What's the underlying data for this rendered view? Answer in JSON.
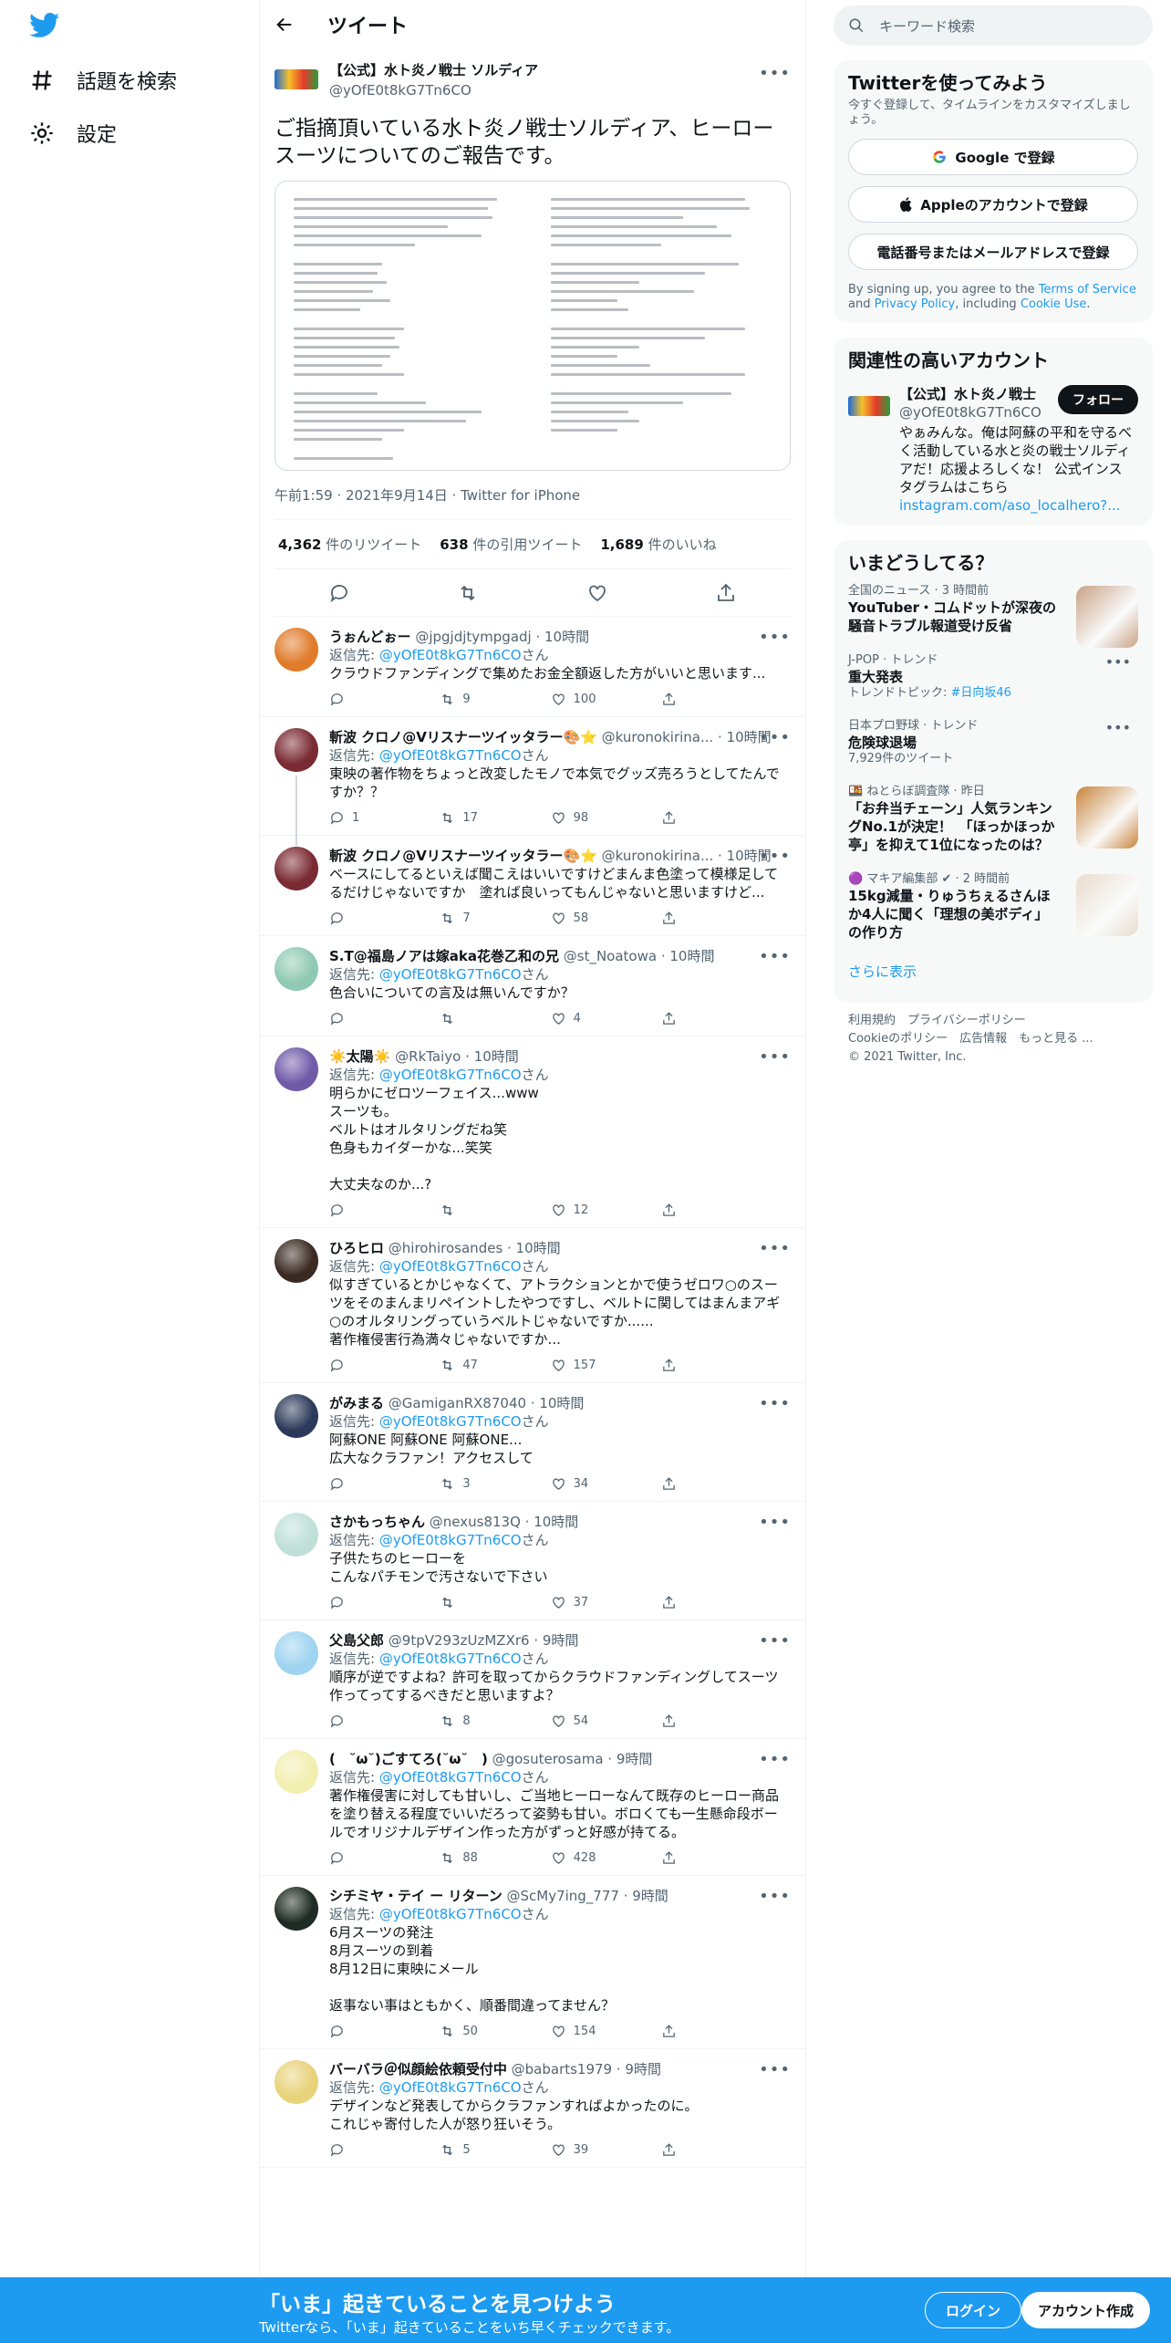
{
  "nav": {
    "explore_label": "話題を検索",
    "settings_label": "設定"
  },
  "header": {
    "title": "ツイート"
  },
  "focal": {
    "display_name": "【公式】水ト炎ノ戦士 ソルディア",
    "handle": "@yOfE0t8kG7Tn6CO",
    "text": "ご指摘頂いている水ト炎ノ戦士ソルディア、ヒーロースーツについてのご報告です。",
    "timestamp": "午前1:59 · 2021年9月14日 · Twitter for iPhone",
    "retweets_n": "4,362",
    "retweets_label": "件のリツイート",
    "quotes_n": "638",
    "quotes_label": "件の引用ツイート",
    "likes_n": "1,689",
    "likes_label": "件のいいね"
  },
  "replies": [
    {
      "name": "うぉんどぉー",
      "handle": "@jpgjdjtympgadj · 10時間",
      "to_label": "返信先:",
      "to_handle": "@yOfE0t8kG7Tn6CO",
      "to_suffix": "さん",
      "text": "クラウドファンディングで集めたお金全額返した方がいいと思います...",
      "replies": "",
      "retweets": "9",
      "likes": "100",
      "color": "#e07b2a"
    },
    {
      "name": "斬波 クロノ@Vリスナーツイッタラー🎨⭐",
      "handle": "@kuronokirina... · 10時間",
      "to_label": "返信先:",
      "to_handle": "@yOfE0t8kG7Tn6CO",
      "to_suffix": "さん",
      "text": "東映の著作物をちょっと改変したモノで本気でグッズ売ろうとしてたんですか？？",
      "replies": "1",
      "retweets": "17",
      "likes": "98",
      "color": "#7a2a33"
    },
    {
      "name": "斬波 クロノ@Vリスナーツイッタラー🎨⭐",
      "handle": "@kuronokirina... · 10時間",
      "to_label": "",
      "to_handle": "",
      "to_suffix": "",
      "text": "ベースにしてるといえば聞こえはいいですけどまんま色塗って模様足してるだけじゃないですか　塗れば良いってもんじゃないと思いますけど...",
      "replies": "",
      "retweets": "7",
      "likes": "58",
      "color": "#7a2a33"
    },
    {
      "name": "S.T@福島ノアは嫁aka花巻乙和の兄",
      "handle": "@st_Noatowa · 10時間",
      "to_label": "返信先:",
      "to_handle": "@yOfE0t8kG7Tn6CO",
      "to_suffix": "さん",
      "text": "色合いについての言及は無いんですか？",
      "replies": "",
      "retweets": "",
      "likes": "4",
      "color": "#8fc9b4"
    },
    {
      "name": "☀️太陽☀️",
      "handle": "@RkTaiyo · 10時間",
      "to_label": "返信先:",
      "to_handle": "@yOfE0t8kG7Tn6CO",
      "to_suffix": "さん",
      "text": "明らかにゼロツーフェイス...www\nスーツも。\nベルトはオルタリングだね笑\n色身もカイダーかな...笑笑\n\n大丈夫なのか...?",
      "replies": "",
      "retweets": "",
      "likes": "12",
      "color": "#6f5aa8"
    },
    {
      "name": "ひろヒロ",
      "handle": "@hirohirosandes · 10時間",
      "to_label": "返信先:",
      "to_handle": "@yOfE0t8kG7Tn6CO",
      "to_suffix": "さん",
      "text": "似すぎているとかじゃなくて、アトラクションとかで使うゼロワ○のスーツをそのまんまリペイントしたやつですし、ベルトに関してはまんまアギ○のオルタリングっていうベルトじゃないですか......\n著作権侵害行為満々じゃないですか...",
      "replies": "",
      "retweets": "47",
      "likes": "157",
      "color": "#3b2a22"
    },
    {
      "name": "がみまる",
      "handle": "@GamiganRX87040 · 10時間",
      "to_label": "返信先:",
      "to_handle": "@yOfE0t8kG7Tn6CO",
      "to_suffix": "さん",
      "text": "阿蘇ONE 阿蘇ONE 阿蘇ONE...\n広大なクラファン！アクセスして",
      "replies": "",
      "retweets": "3",
      "likes": "34",
      "color": "#2b3a5a"
    },
    {
      "name": "さかもっちゃん",
      "handle": "@nexus813Q · 10時間",
      "to_label": "返信先:",
      "to_handle": "@yOfE0t8kG7Tn6CO",
      "to_suffix": "さん",
      "text": "子供たちのヒーローを\nこんなパチモンで汚さないで下さい",
      "replies": "",
      "retweets": "",
      "likes": "37",
      "color": "#bfe0d8"
    },
    {
      "name": "父島父郎",
      "handle": "@9tpV293zUzMZXr6 · 9時間",
      "to_label": "返信先:",
      "to_handle": "@yOfE0t8kG7Tn6CO",
      "to_suffix": "さん",
      "text": "順序が逆ですよね？許可を取ってからクラウドファンディングしてスーツ作ってってするべきだと思いますよ？",
      "replies": "",
      "retweets": "8",
      "likes": "54",
      "color": "#9ed4f0"
    },
    {
      "name": "(　˘ω˘)ごすてろ(˘ω˘　)",
      "handle": "@gosuterosama · 9時間",
      "to_label": "返信先:",
      "to_handle": "@yOfE0t8kG7Tn6CO",
      "to_suffix": "さん",
      "text": "著作権侵害に対しても甘いし、ご当地ヒーローなんて既存のヒーロー商品を塗り替える程度でいいだろって姿勢も甘い。ボロくても一生懸命段ボールでオリジナルデザイン作った方がずっと好感が持てる。",
      "replies": "",
      "retweets": "88",
      "likes": "428",
      "color": "#f2efb0"
    },
    {
      "name": "シチミヤ・テイ ー リターン",
      "handle": "@ScMy7ing_777 · 9時間",
      "to_label": "返信先:",
      "to_handle": "@yOfE0t8kG7Tn6CO",
      "to_suffix": "さん",
      "text": "6月スーツの発注\n8月スーツの到着\n8月12日に東映にメール\n\n返事ない事はともかく、順番間違ってません？",
      "replies": "",
      "retweets": "50",
      "likes": "154",
      "color": "#1e2a24"
    },
    {
      "name": "バーバラ＠似顔絵依頼受付中",
      "handle": "@babarts1979 · 9時間",
      "to_label": "返信先:",
      "to_handle": "@yOfE0t8kG7Tn6CO",
      "to_suffix": "さん",
      "text": "デザインなど発表してからクラファンすればよかったのに。\nこれじゃ寄付した人が怒り狂いそう。",
      "replies": "",
      "retweets": "5",
      "likes": "39",
      "color": "#e8d27a"
    }
  ],
  "search": {
    "placeholder": "キーワード検索"
  },
  "signup_card": {
    "title": "Twitterを使ってみよう",
    "subtitle": "今すぐ登録して、タイムラインをカスタマイズしましょう。",
    "google": "Google で登録",
    "apple": "Appleのアカウントで登録",
    "phone": "電話番号またはメールアドレスで登録",
    "terms_pre": "By signing up, you agree to the ",
    "terms_tos": "Terms of Service",
    "terms_and": " and ",
    "terms_pp": "Privacy Policy",
    "terms_inc": ", including ",
    "terms_cookie": "Cookie Use",
    "terms_end": "."
  },
  "related": {
    "title": "関連性の高いアカウント",
    "name": "【公式】水ト炎ノ戦士",
    "handle": "@yOfE0t8kG7Tn6CO",
    "follow": "フォロー",
    "bio": "やぁみんな。俺は阿蘇の平和を守るべく活動している水と炎の戦士ソルディアだ！応援よろしくな！ 公式インスタグラムはこちら",
    "link": "instagram.com/aso_localhero?..."
  },
  "trends": {
    "title": "いまどうしてる？",
    "items": [
      {
        "cat": "全国のニュース · 3 時間前",
        "title": "YouTuber・コムドットが深夜の騒音トラブル報道受け反省",
        "extra_pre": "",
        "extra_link": "",
        "color": "#c9a184"
      },
      {
        "cat": "J-POP · トレンド",
        "title": "重大発表",
        "extra_pre": "トレンドトピック: ",
        "extra_link": "#日向坂46",
        "color": ""
      },
      {
        "cat": "日本プロ野球 · トレンド",
        "title": "危険球退場",
        "extra_pre": "7,929件のツイート",
        "extra_link": "",
        "color": ""
      },
      {
        "cat": "🍱 ねとらぼ調査隊 · 昨日",
        "title": "「お弁当チェーン」人気ランキングNo.1が決定！　「ほっかほっか亭」を抑えて1位になったのは？",
        "extra_pre": "",
        "extra_link": "",
        "color": "#c9843a"
      },
      {
        "cat": "🟣 マキア編集部 ✔ · 2 時間前",
        "title": "15kg減量・りゅうちぇるさんほか4人に聞く「理想の美ボディ」の作り方",
        "extra_pre": "",
        "extra_link": "",
        "color": "#e9dccc"
      }
    ],
    "show_more": "さらに表示"
  },
  "footer": {
    "l1": "利用規約　プライバシーポリシー",
    "l2": "Cookieのポリシー　広告情報　もっと見る ...",
    "l3": "© 2021 Twitter, Inc."
  },
  "bottom": {
    "headline": "「いま」起きていることを見つけよう",
    "sub": "Twitterなら、「いま」起きていることをいち早くチェックできます。",
    "login": "ログイン",
    "signup": "アカウント作成"
  }
}
